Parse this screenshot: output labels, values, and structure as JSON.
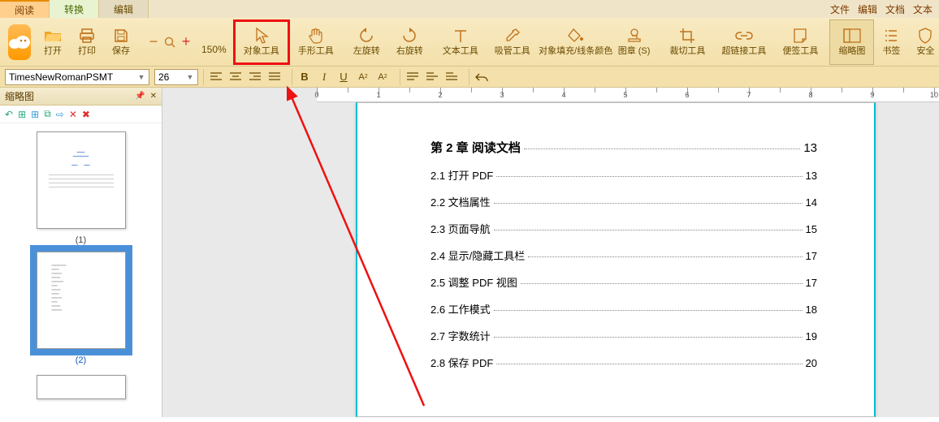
{
  "tabs": {
    "read": "阅读",
    "convert": "转换",
    "edit": "编辑"
  },
  "menu": {
    "file": "文件",
    "edit": "编辑",
    "doc": "文档",
    "text": "文本"
  },
  "toolbar": {
    "open": "打开",
    "print": "打印",
    "save": "保存",
    "zoom": "150%",
    "object_tool": "对象工具",
    "hand_tool": "手形工具",
    "rotate_left": "左旋转",
    "rotate_right": "右旋转",
    "text_tool": "文本工具",
    "eyedropper": "吸管工具",
    "fill_color": "对象填充/线条颜色",
    "stamp": "图章 (S)",
    "crop": "裁切工具",
    "hyperlink": "超链接工具",
    "note": "便签工具",
    "thumbnail": "缩略图",
    "bookmark": "书签",
    "security": "安全"
  },
  "fmt": {
    "font": "TimesNewRomanPSMT",
    "size": "26"
  },
  "thumb": {
    "title": "缩略图",
    "page1": "(1)",
    "page2": "(2)"
  },
  "chart_data": {
    "type": "table",
    "title": "第 2 章  阅读文档",
    "title_page": "13",
    "rows": [
      {
        "label": "2.1 打开 PDF",
        "page": "13"
      },
      {
        "label": "2.2 文档属性",
        "page": "14"
      },
      {
        "label": "2.3 页面导航",
        "page": "15"
      },
      {
        "label": "2.4 显示/隐藏工具栏",
        "page": "17"
      },
      {
        "label": "2.5 调整 PDF 视图",
        "page": "17"
      },
      {
        "label": "2.6 工作模式",
        "page": "18"
      },
      {
        "label": "2.7 字数统计",
        "page": "19"
      },
      {
        "label": "2.8 保存 PDF",
        "page": "20"
      }
    ]
  }
}
